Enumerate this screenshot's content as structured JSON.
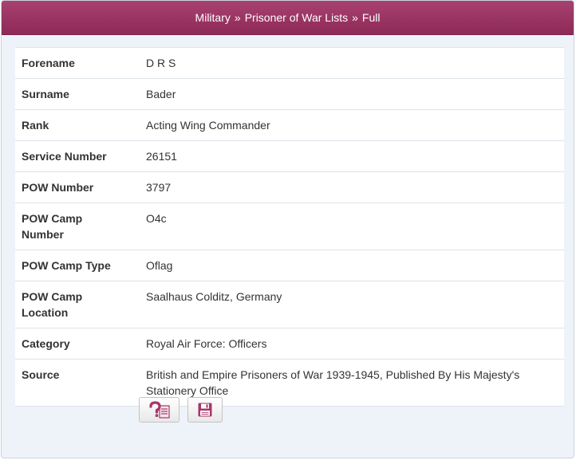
{
  "header": {
    "crumbs": [
      "Military",
      "Prisoner of War Lists",
      "Full"
    ],
    "separator": "»"
  },
  "record": [
    {
      "label": "Forename",
      "value": "D R S"
    },
    {
      "label": "Surname",
      "value": "Bader"
    },
    {
      "label": "Rank",
      "value": "Acting Wing Commander"
    },
    {
      "label": "Service Number",
      "value": "26151"
    },
    {
      "label": "POW Number",
      "value": "3797"
    },
    {
      "label": "POW Camp Number",
      "value": "O4c"
    },
    {
      "label": "POW Camp Type",
      "value": "Oflag"
    },
    {
      "label": "POW Camp Location",
      "value": "Saalhaus Colditz, Germany"
    },
    {
      "label": "Category",
      "value": "Royal Air Force: Officers"
    },
    {
      "label": "Source",
      "value": "British and Empire Prisoners of War 1939-1945, Published By His Majesty's Stationery Office"
    }
  ],
  "buttons": {
    "query_icon": "question-document-icon",
    "save_icon": "floppy-disk-icon"
  },
  "colors": {
    "header": "#9b3563",
    "accent": "#a8356a",
    "panel": "#eef3f9"
  }
}
